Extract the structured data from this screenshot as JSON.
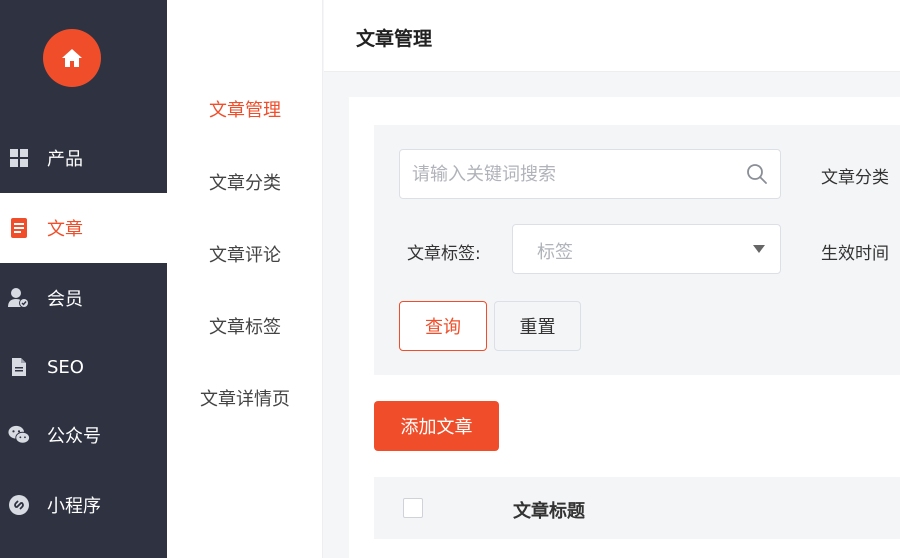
{
  "sidebar": {
    "logo_icon": "home-icon",
    "items": [
      {
        "label": "产品",
        "icon": "grid-icon"
      },
      {
        "label": "文章",
        "icon": "document-icon",
        "active": true
      },
      {
        "label": "会员",
        "icon": "member-icon"
      },
      {
        "label": "SEO",
        "icon": "file-icon"
      },
      {
        "label": "公众号",
        "icon": "wechat-icon"
      },
      {
        "label": "小程序",
        "icon": "mini-program-icon"
      }
    ]
  },
  "submenu": {
    "items": [
      {
        "label": "文章管理",
        "active": true
      },
      {
        "label": "文章分类"
      },
      {
        "label": "文章评论"
      },
      {
        "label": "文章标签"
      },
      {
        "label": "文章详情页"
      }
    ]
  },
  "header": {
    "title": "文章管理"
  },
  "filter": {
    "search_placeholder": "请输入关键词搜索",
    "category_label": "文章分类",
    "tag_label": "文章标签:",
    "tag_placeholder": "标签",
    "time_label": "生效时间",
    "query_button": "查询",
    "reset_button": "重置"
  },
  "actions": {
    "add_button": "添加文章"
  },
  "table": {
    "columns": [
      "文章标题"
    ]
  },
  "colors": {
    "accent": "#f04e2a",
    "sidebar_bg": "#2f3341"
  }
}
